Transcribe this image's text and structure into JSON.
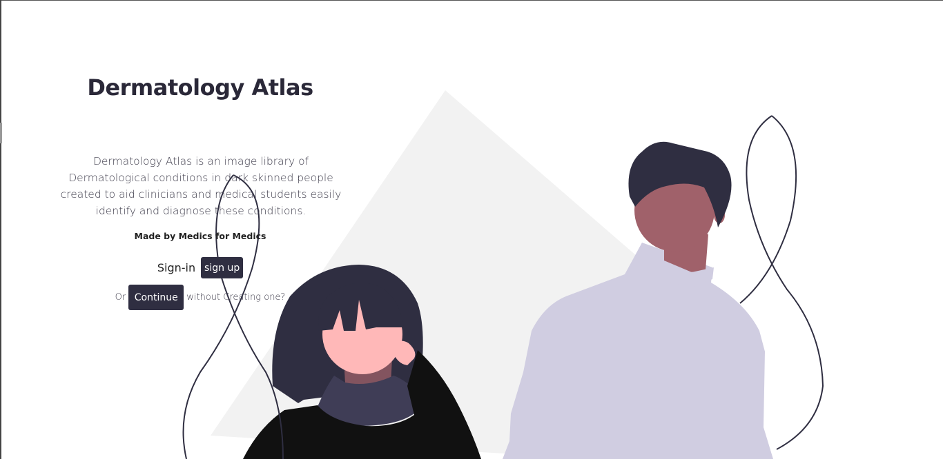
{
  "header": {
    "title": "Dermatology Atlas"
  },
  "intro": {
    "description": "Dermatology Atlas is an image library of Dermatological conditions in dark skinned people created to aid clinicians and medical students easily identify and diagnose these conditions.",
    "tagline": "Made by Medics for Medics"
  },
  "auth": {
    "signin_label": "Sign-in",
    "signup_label": "sign up",
    "or_label": "Or",
    "continue_label": "Continue",
    "continue_suffix": "without Creating one?"
  },
  "colors": {
    "primary_dark": "#2f2e41",
    "figure_sweater": "#d0cde1",
    "background_diamond": "#f2f2f2",
    "skin_light": "#ffb8b8",
    "skin_dark": "#a0616a"
  },
  "illustration": {
    "name": "two-people-illustration"
  }
}
